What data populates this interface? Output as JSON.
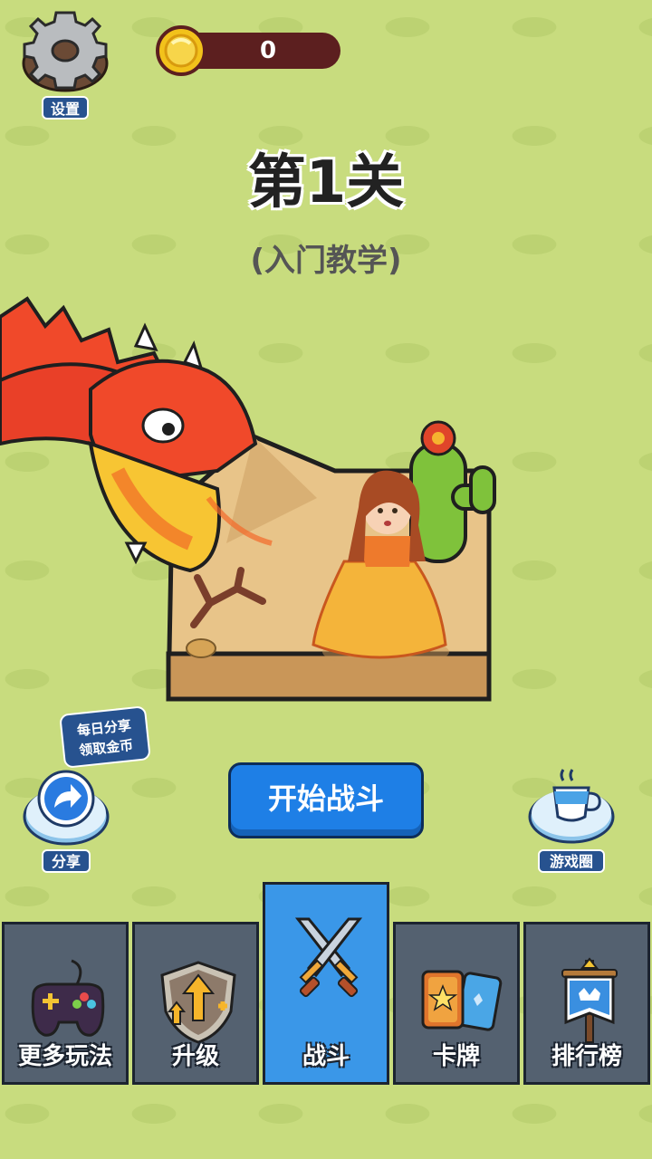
{
  "header": {
    "settings_label": "设置",
    "coin_count": "0"
  },
  "level": {
    "title": "第1关",
    "subtitle": "(入门教学)"
  },
  "actions": {
    "daily_share_line1": "每日分享",
    "daily_share_line2": "领取金币",
    "share_label": "分享",
    "start_label": "开始战斗",
    "circle_label": "游戏圈"
  },
  "nav": {
    "items": [
      {
        "label": "更多玩法",
        "icon": "gamepad-icon"
      },
      {
        "label": "升级",
        "icon": "upgrade-shield-icon"
      },
      {
        "label": "战斗",
        "icon": "crossed-swords-icon",
        "active": true
      },
      {
        "label": "卡牌",
        "icon": "cards-icon"
      },
      {
        "label": "排行榜",
        "icon": "leaderboard-banner-icon"
      }
    ]
  },
  "colors": {
    "background": "#c8dc7e",
    "accent_blue": "#1e7fe6",
    "nav_bg": "#546170",
    "nav_active": "#3a97e8",
    "label_bg": "#27528f"
  }
}
